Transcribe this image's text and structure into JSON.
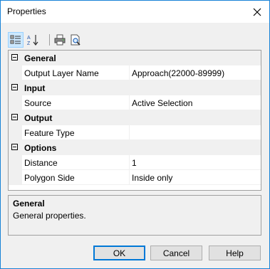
{
  "window": {
    "title": "Properties"
  },
  "toolbar": {
    "buttons": [
      {
        "icon": "categorized-icon"
      },
      {
        "icon": "sort-alphabetical-icon"
      },
      {
        "icon": "print-icon"
      },
      {
        "icon": "print-preview-icon"
      }
    ]
  },
  "grid": {
    "categories": [
      {
        "label": "General",
        "properties": [
          {
            "name": "Output Layer Name",
            "value": "Approach(22000-89999)"
          }
        ]
      },
      {
        "label": "Input",
        "properties": [
          {
            "name": "Source",
            "value": "Active Selection"
          }
        ]
      },
      {
        "label": "Output",
        "properties": [
          {
            "name": "Feature Type",
            "value": ""
          }
        ]
      },
      {
        "label": "Options",
        "properties": [
          {
            "name": "Distance",
            "value": "1"
          },
          {
            "name": "Polygon Side",
            "value": "Inside only"
          }
        ]
      }
    ]
  },
  "description": {
    "title": "General",
    "text": "General properties."
  },
  "buttons": {
    "ok": "OK",
    "cancel": "Cancel",
    "help": "Help"
  },
  "colors": {
    "accent": "#0078d7",
    "window_border": "#1883d7",
    "selected_tool": "#cce8ff"
  }
}
